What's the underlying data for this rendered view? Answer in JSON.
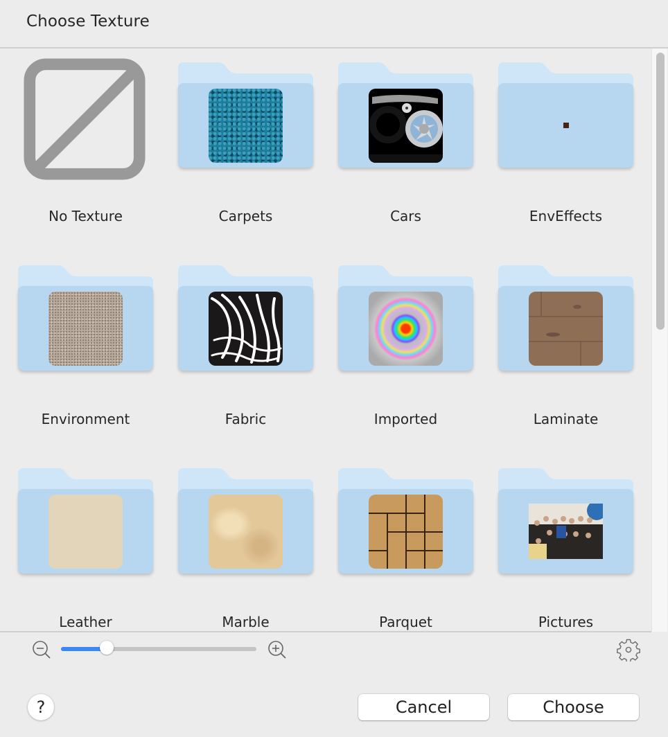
{
  "dialog": {
    "title": "Choose Texture"
  },
  "items": [
    {
      "label": "No Texture",
      "type": "none"
    },
    {
      "label": "Carpets",
      "type": "folder",
      "preview": "carpet-teal"
    },
    {
      "label": "Cars",
      "type": "folder",
      "preview": "car-wheel"
    },
    {
      "label": "EnvEffects",
      "type": "folder",
      "preview": "tiny-dot"
    },
    {
      "label": "Environment",
      "type": "folder",
      "preview": "sand"
    },
    {
      "label": "Fabric",
      "type": "folder",
      "preview": "zebra"
    },
    {
      "label": "Imported",
      "type": "folder",
      "preview": "rainbow-rings"
    },
    {
      "label": "Laminate",
      "type": "folder",
      "preview": "wood-planks"
    },
    {
      "label": "Leather",
      "type": "folder",
      "preview": "beige-leather"
    },
    {
      "label": "Marble",
      "type": "folder",
      "preview": "marble-beige"
    },
    {
      "label": "Parquet",
      "type": "folder",
      "preview": "parquet-basketweave"
    },
    {
      "label": "Pictures",
      "type": "folder",
      "preview": "group-photo"
    }
  ],
  "zoom_slider": {
    "value_percent": 22,
    "min_icon": "zoom-out-icon",
    "max_icon": "zoom-in-icon"
  },
  "scrollbar": {
    "position_percent": 0
  },
  "buttons": {
    "help": "?",
    "cancel": "Cancel",
    "choose": "Choose"
  },
  "colors": {
    "folder_front": "#b7d6ef",
    "folder_back": "#cfe5f8",
    "accent": "#3b88f5",
    "background": "#ececec"
  }
}
